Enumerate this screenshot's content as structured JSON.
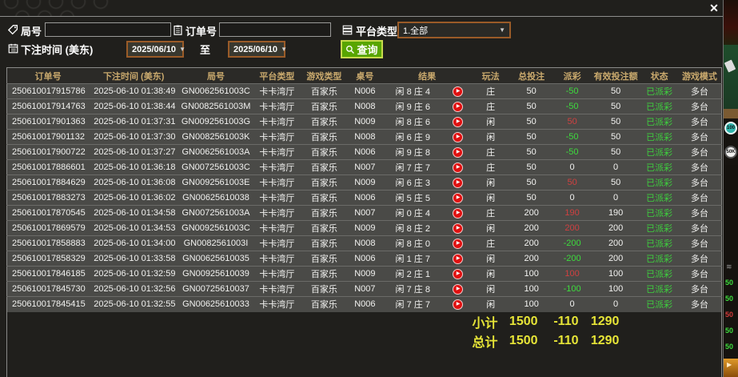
{
  "window": {
    "close_label": "✕"
  },
  "filters": {
    "round_label": "局号",
    "round_value": "",
    "order_label": "订单号",
    "order_value": "",
    "platform_label": "平台类型",
    "platform_value": "1.全部",
    "time_label": "下注时间 (美东)",
    "date_from": "2025/06/10",
    "to_label": "至",
    "date_to": "2025/06/10",
    "query_label": "查询"
  },
  "table": {
    "headers": [
      "订单号",
      "下注时间 (美东)",
      "局号",
      "平台类型",
      "游戏类型",
      "桌号",
      "结果",
      "玩法",
      "总投注",
      "派彩",
      "有效投注额",
      "状态",
      "游戏模式"
    ],
    "rows": [
      {
        "order": "250610017915786",
        "time": "2025-06-10 01:38:49",
        "round": "GN0062561003C",
        "platform": "卡卡湾厅",
        "game": "百家乐",
        "table_no": "N006",
        "result": "闲 8 庄 4",
        "play": "庄",
        "bet": "50",
        "payout": "-50",
        "valid": "50",
        "status": "已派彩",
        "mode": "多台"
      },
      {
        "order": "250610017914763",
        "time": "2025-06-10 01:38:44",
        "round": "GN0082561003M",
        "platform": "卡卡湾厅",
        "game": "百家乐",
        "table_no": "N008",
        "result": "闲 9 庄 6",
        "play": "庄",
        "bet": "50",
        "payout": "-50",
        "valid": "50",
        "status": "已派彩",
        "mode": "多台"
      },
      {
        "order": "250610017901363",
        "time": "2025-06-10 01:37:31",
        "round": "GN0092561003G",
        "platform": "卡卡湾厅",
        "game": "百家乐",
        "table_no": "N009",
        "result": "闲 8 庄 6",
        "play": "闲",
        "bet": "50",
        "payout": "50",
        "valid": "50",
        "status": "已派彩",
        "mode": "多台"
      },
      {
        "order": "250610017901132",
        "time": "2025-06-10 01:37:30",
        "round": "GN0082561003K",
        "platform": "卡卡湾厅",
        "game": "百家乐",
        "table_no": "N008",
        "result": "闲 6 庄 9",
        "play": "闲",
        "bet": "50",
        "payout": "-50",
        "valid": "50",
        "status": "已派彩",
        "mode": "多台"
      },
      {
        "order": "250610017900722",
        "time": "2025-06-10 01:37:27",
        "round": "GN0062561003A",
        "platform": "卡卡湾厅",
        "game": "百家乐",
        "table_no": "N006",
        "result": "闲 9 庄 8",
        "play": "庄",
        "bet": "50",
        "payout": "-50",
        "valid": "50",
        "status": "已派彩",
        "mode": "多台"
      },
      {
        "order": "250610017886601",
        "time": "2025-06-10 01:36:18",
        "round": "GN0072561003C",
        "platform": "卡卡湾厅",
        "game": "百家乐",
        "table_no": "N007",
        "result": "闲 7 庄 7",
        "play": "庄",
        "bet": "50",
        "payout": "0",
        "valid": "0",
        "status": "已派彩",
        "mode": "多台"
      },
      {
        "order": "250610017884629",
        "time": "2025-06-10 01:36:08",
        "round": "GN0092561003E",
        "platform": "卡卡湾厅",
        "game": "百家乐",
        "table_no": "N009",
        "result": "闲 6 庄 3",
        "play": "闲",
        "bet": "50",
        "payout": "50",
        "valid": "50",
        "status": "已派彩",
        "mode": "多台"
      },
      {
        "order": "250610017883273",
        "time": "2025-06-10 01:36:02",
        "round": "GN00625610038",
        "platform": "卡卡湾厅",
        "game": "百家乐",
        "table_no": "N006",
        "result": "闲 5 庄 5",
        "play": "闲",
        "bet": "50",
        "payout": "0",
        "valid": "0",
        "status": "已派彩",
        "mode": "多台"
      },
      {
        "order": "250610017870545",
        "time": "2025-06-10 01:34:58",
        "round": "GN0072561003A",
        "platform": "卡卡湾厅",
        "game": "百家乐",
        "table_no": "N007",
        "result": "闲 0 庄 4",
        "play": "庄",
        "bet": "200",
        "payout": "190",
        "valid": "190",
        "status": "已派彩",
        "mode": "多台"
      },
      {
        "order": "250610017869579",
        "time": "2025-06-10 01:34:53",
        "round": "GN0092561003C",
        "platform": "卡卡湾厅",
        "game": "百家乐",
        "table_no": "N009",
        "result": "闲 8 庄 2",
        "play": "闲",
        "bet": "200",
        "payout": "200",
        "valid": "200",
        "status": "已派彩",
        "mode": "多台"
      },
      {
        "order": "250610017858883",
        "time": "2025-06-10 01:34:00",
        "round": "GN0082561003I",
        "platform": "卡卡湾厅",
        "game": "百家乐",
        "table_no": "N008",
        "result": "闲 8 庄 0",
        "play": "庄",
        "bet": "200",
        "payout": "-200",
        "valid": "200",
        "status": "已派彩",
        "mode": "多台"
      },
      {
        "order": "250610017858329",
        "time": "2025-06-10 01:33:58",
        "round": "GN00625610035",
        "platform": "卡卡湾厅",
        "game": "百家乐",
        "table_no": "N006",
        "result": "闲 1 庄 7",
        "play": "闲",
        "bet": "200",
        "payout": "-200",
        "valid": "200",
        "status": "已派彩",
        "mode": "多台"
      },
      {
        "order": "250610017846185",
        "time": "2025-06-10 01:32:59",
        "round": "GN00925610039",
        "platform": "卡卡湾厅",
        "game": "百家乐",
        "table_no": "N009",
        "result": "闲 2 庄 1",
        "play": "闲",
        "bet": "100",
        "payout": "100",
        "valid": "100",
        "status": "已派彩",
        "mode": "多台"
      },
      {
        "order": "250610017845730",
        "time": "2025-06-10 01:32:56",
        "round": "GN00725610037",
        "platform": "卡卡湾厅",
        "game": "百家乐",
        "table_no": "N007",
        "result": "闲 7 庄 8",
        "play": "闲",
        "bet": "100",
        "payout": "-100",
        "valid": "100",
        "status": "已派彩",
        "mode": "多台"
      },
      {
        "order": "250610017845415",
        "time": "2025-06-10 01:32:55",
        "round": "GN00625610033",
        "platform": "卡卡湾厅",
        "game": "百家乐",
        "table_no": "N006",
        "result": "闲 7 庄 7",
        "play": "闲",
        "bet": "100",
        "payout": "0",
        "valid": "0",
        "status": "已派彩",
        "mode": "多台"
      }
    ],
    "subtotal": {
      "label": "小计",
      "bet": "1500",
      "payout": "-110",
      "valid": "1290"
    },
    "total": {
      "label": "总计",
      "bet": "1500",
      "payout": "-110",
      "valid": "1290"
    }
  },
  "background": {
    "chip_100": "100",
    "chip_50k": "50K",
    "amounts": [
      "50",
      "50",
      "50",
      "50",
      "50"
    ]
  }
}
